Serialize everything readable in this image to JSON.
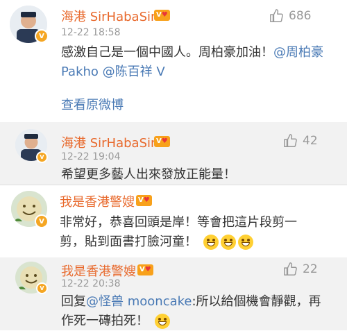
{
  "comments": [
    {
      "user": "海港 SirHabaSir",
      "time": "12-22 18:58",
      "likes": "686",
      "text_main": "感激自己是一個中國人。周柏豪加油！",
      "mention1": "@周柏豪 Pakho",
      "mention2": "@陈百祥",
      "mention2_suffix": "V",
      "view_original": "查看原微博"
    },
    {
      "user": "海港 SirHabaSir",
      "time": "12-22 19:04",
      "likes": "42",
      "text": "希望更多藝人出來發放正能量！"
    },
    {
      "user": "我是香港警嫂",
      "line1": "非常好，恭喜回頭是岸！等會把這片段剪一",
      "line2": "剪，貼到面書打臉河童！"
    },
    {
      "user": "我是香港警嫂",
      "time": "12-22 20:38",
      "likes": "22",
      "reply_prefix": "回复",
      "reply_mention": "@怪兽 mooncake",
      "reply_rest": ":所以給個機會靜觀，再",
      "line2": "作死一磚拍死！"
    }
  ],
  "colors": {
    "name": "#e8692c",
    "link": "#4a7ab5",
    "sub_bg": "#f2f2f2"
  },
  "icons": {
    "like": "thumbs-up-icon",
    "vip": "vip-heart-icon",
    "verified": "verified-badge-icon",
    "emoji": "grin-emoji-icon"
  }
}
